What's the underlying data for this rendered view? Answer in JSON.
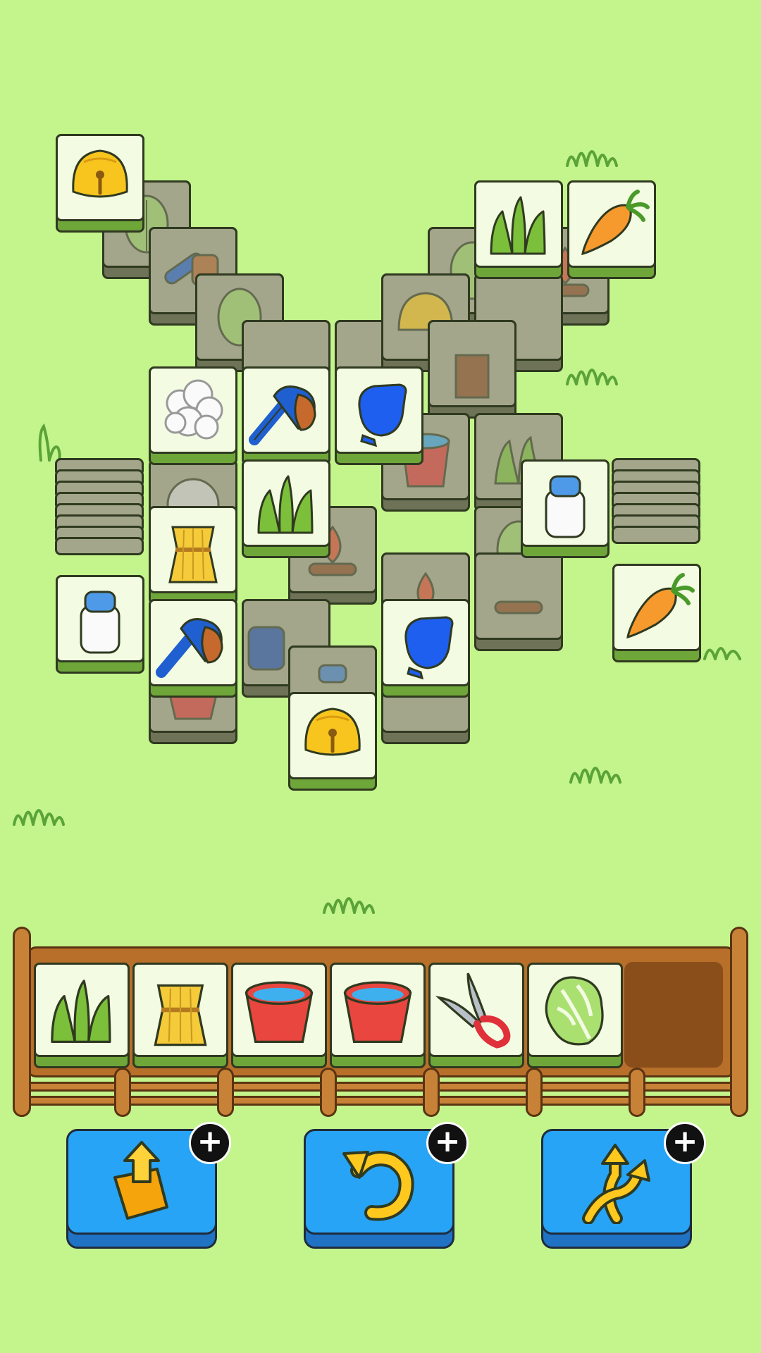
{
  "board": {
    "free_tiles": [
      "bell",
      "grass",
      "carrot",
      "wool",
      "brush",
      "glove",
      "grass",
      "milk",
      "wheat",
      "milk",
      "carrot",
      "brush",
      "glove",
      "bell"
    ],
    "locked_tiles": [
      "cabbage",
      "brush",
      "cabbage",
      "cabbage",
      "carrot-campfire",
      "bell",
      "bell",
      "tree-stump",
      "bucket",
      "grass",
      "campfire",
      "cabbage",
      "campfire",
      "campfire",
      "wool",
      "brush",
      "bucket",
      "milk"
    ]
  },
  "tray": {
    "capacity": 7,
    "slots": [
      "grass",
      "wheat",
      "bucket",
      "bucket",
      "shears",
      "cabbage"
    ]
  },
  "powerups": [
    {
      "name": "remove",
      "icon": "return-tiles-icon",
      "badge": "+"
    },
    {
      "name": "undo",
      "icon": "undo-icon",
      "badge": "+"
    },
    {
      "name": "shuffle",
      "icon": "shuffle-icon",
      "badge": "+"
    }
  ],
  "colors": {
    "background": "#c4f48c",
    "tile_free": "#f3fbe2",
    "tile_locked": "#a3a68a",
    "button": "#27a4f6",
    "fence": "#b86f2a"
  }
}
